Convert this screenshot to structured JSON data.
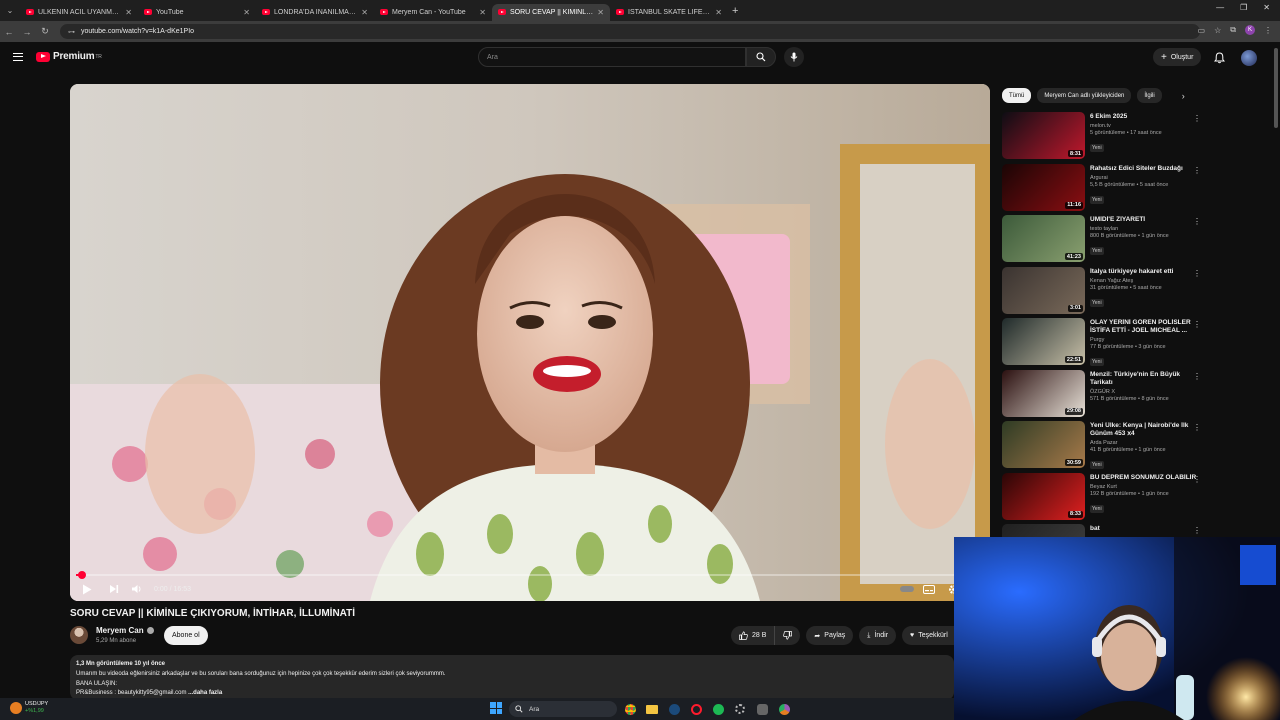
{
  "browser": {
    "tabs": [
      {
        "label": "ÜLKENİN ACİL UYANMASI GERE",
        "active": false
      },
      {
        "label": "YouTube",
        "active": false
      },
      {
        "label": "LONDRA'DA İNANILMAZ SOKA",
        "active": false
      },
      {
        "label": "Meryem Can - YouTube",
        "active": false
      },
      {
        "label": "SORU CEVAP || KİMİNLE ÇIKIYO",
        "active": true
      },
      {
        "label": "İSTANBUL SKATE LIFE - YouTube",
        "active": false
      }
    ],
    "url": "youtube.com/watch?v=k1A-dKe1PIo",
    "profile_initial": "K"
  },
  "header": {
    "logo_text": "Premium",
    "logo_sup": "TR",
    "search_placeholder": "Ara",
    "create_label": "Oluştur"
  },
  "player": {
    "time": "0:00 / 16:53",
    "progress_fraction": 0.004
  },
  "video": {
    "title": "SORU CEVAP || KİMİNLE ÇIKIYORUM, İNTİHAR, İLLUMİNATİ",
    "channel": "Meryem Can",
    "subscribers": "5,29 Mn abone",
    "subscribe_label": "Abone ol",
    "likes": "28 B",
    "share_label": "Paylaş",
    "download_label": "İndir",
    "thanks_label": "Teşekkürl"
  },
  "description": {
    "stats": "1,3 Mn görüntüleme  10 yıl önce",
    "line1": "Umarım bu videoda eğlenirsiniz arkadaşlar ve bu soruları bana sorduğunuz için hepinize çok çok teşekkür ederim sizleri çok seviyorummm.",
    "line2": "BANA ULAŞIN:",
    "line3": "PR&Business : beautykitty95@gmail.com",
    "more": "...daha fazla"
  },
  "chips": [
    "Tümü",
    "Meryem Can adlı yükleyiciden",
    "İlgili"
  ],
  "recommendations": [
    {
      "title": "6 Ekim 2025",
      "channel": "melon.tv",
      "meta": "5 görüntüleme • 17 saat önce",
      "badge": "Yeni",
      "duration": "8:31",
      "thumb_colors": [
        "#0d0d14",
        "#c0182c"
      ]
    },
    {
      "title": "Rahatsız Edici Siteler Buzdağı",
      "channel": "Argurai",
      "meta": "5,5 B görüntüleme • 5 saat önce",
      "badge": "Yeni",
      "duration": "11:16",
      "thumb_colors": [
        "#1a0505",
        "#8b0e12"
      ]
    },
    {
      "title": "ÜMİDİ'E ZİYARETİ",
      "channel": "testo taylan",
      "meta": "800 B görüntüleme • 1 gün önce",
      "badge": "Yeni",
      "duration": "41:23",
      "thumb_colors": [
        "#3c5a3a",
        "#8aa070"
      ]
    },
    {
      "title": "İtalya türkiyeye hakaret etti",
      "channel": "Kenan Yağız Ateş",
      "meta": "31 görüntüleme • 5 saat önce",
      "badge": "Yeni",
      "duration": "3:01",
      "thumb_colors": [
        "#3a3330",
        "#7a6a5a"
      ]
    },
    {
      "title": "OLAY YERİNİ GÖREN POLİSLER İSTİFA ETTİ - JOEL MICHEAL ...",
      "channel": "Purgy",
      "meta": "77 B görüntüleme • 3 gün önce",
      "badge": "Yeni",
      "duration": "22:51",
      "thumb_colors": [
        "#1f2a2a",
        "#c8c0a8"
      ]
    },
    {
      "title": "Menzil: Türkiye'nin En Büyük Tarikatı",
      "channel": "ÖZGÜR X",
      "meta": "571 B görüntüleme • 8 gün önce",
      "badge": "",
      "duration": "29:08",
      "thumb_colors": [
        "#2b1010",
        "#e8e2d8"
      ]
    },
    {
      "title": "Yeni Ülke: Kenya | Nairobi'de İlk Günüm 453 ⅹ4",
      "channel": "Arda Pazar",
      "meta": "41 B görüntüleme • 1 gün önce",
      "badge": "Yeni",
      "duration": "30:59",
      "thumb_colors": [
        "#2e3b24",
        "#a87a4a"
      ]
    },
    {
      "title": "BU DEPREM SONUMUZ OLABİLİR",
      "channel": "Beyaz Kurt",
      "meta": "192 B görüntüleme • 1 gün önce",
      "badge": "Yeni",
      "duration": "8:33",
      "thumb_colors": [
        "#2a0606",
        "#e02020"
      ]
    },
    {
      "title": "bat",
      "channel": "",
      "meta": "",
      "badge": "",
      "duration": "",
      "thumb_colors": [
        "#202020",
        "#404040"
      ]
    }
  ],
  "taskbar": {
    "ticker_label": "USD/JPY",
    "ticker_change": "+%1,99",
    "search_placeholder": "Ara"
  },
  "colors": {
    "accent": "#ff0033",
    "background": "#0f0f0f",
    "surface": "#272727"
  }
}
